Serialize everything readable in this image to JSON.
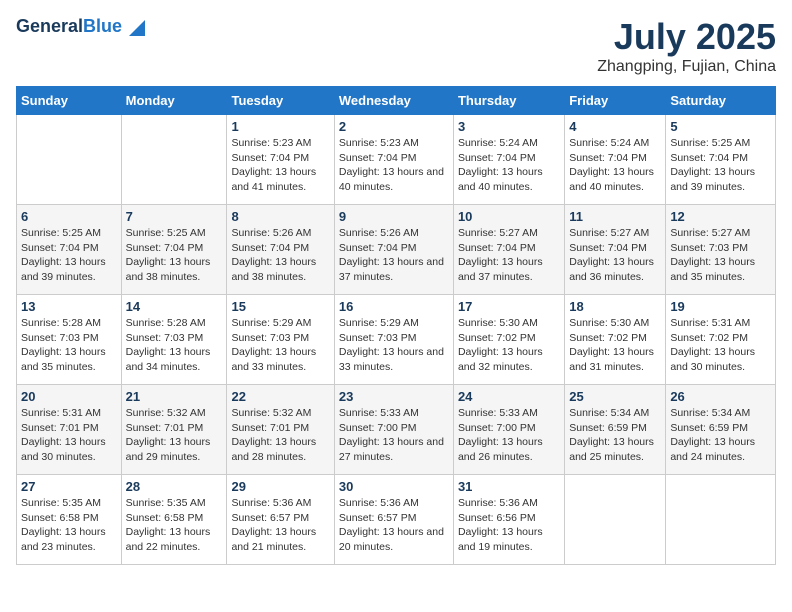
{
  "header": {
    "logo_general": "General",
    "logo_blue": "Blue",
    "month": "July 2025",
    "location": "Zhangping, Fujian, China"
  },
  "weekdays": [
    "Sunday",
    "Monday",
    "Tuesday",
    "Wednesday",
    "Thursday",
    "Friday",
    "Saturday"
  ],
  "weeks": [
    [
      {
        "day": "",
        "info": ""
      },
      {
        "day": "",
        "info": ""
      },
      {
        "day": "1",
        "sunrise": "5:23 AM",
        "sunset": "7:04 PM",
        "daylight": "13 hours and 41 minutes."
      },
      {
        "day": "2",
        "sunrise": "5:23 AM",
        "sunset": "7:04 PM",
        "daylight": "13 hours and 40 minutes."
      },
      {
        "day": "3",
        "sunrise": "5:24 AM",
        "sunset": "7:04 PM",
        "daylight": "13 hours and 40 minutes."
      },
      {
        "day": "4",
        "sunrise": "5:24 AM",
        "sunset": "7:04 PM",
        "daylight": "13 hours and 40 minutes."
      },
      {
        "day": "5",
        "sunrise": "5:25 AM",
        "sunset": "7:04 PM",
        "daylight": "13 hours and 39 minutes."
      }
    ],
    [
      {
        "day": "6",
        "sunrise": "5:25 AM",
        "sunset": "7:04 PM",
        "daylight": "13 hours and 39 minutes."
      },
      {
        "day": "7",
        "sunrise": "5:25 AM",
        "sunset": "7:04 PM",
        "daylight": "13 hours and 38 minutes."
      },
      {
        "day": "8",
        "sunrise": "5:26 AM",
        "sunset": "7:04 PM",
        "daylight": "13 hours and 38 minutes."
      },
      {
        "day": "9",
        "sunrise": "5:26 AM",
        "sunset": "7:04 PM",
        "daylight": "13 hours and 37 minutes."
      },
      {
        "day": "10",
        "sunrise": "5:27 AM",
        "sunset": "7:04 PM",
        "daylight": "13 hours and 37 minutes."
      },
      {
        "day": "11",
        "sunrise": "5:27 AM",
        "sunset": "7:04 PM",
        "daylight": "13 hours and 36 minutes."
      },
      {
        "day": "12",
        "sunrise": "5:27 AM",
        "sunset": "7:03 PM",
        "daylight": "13 hours and 35 minutes."
      }
    ],
    [
      {
        "day": "13",
        "sunrise": "5:28 AM",
        "sunset": "7:03 PM",
        "daylight": "13 hours and 35 minutes."
      },
      {
        "day": "14",
        "sunrise": "5:28 AM",
        "sunset": "7:03 PM",
        "daylight": "13 hours and 34 minutes."
      },
      {
        "day": "15",
        "sunrise": "5:29 AM",
        "sunset": "7:03 PM",
        "daylight": "13 hours and 33 minutes."
      },
      {
        "day": "16",
        "sunrise": "5:29 AM",
        "sunset": "7:03 PM",
        "daylight": "13 hours and 33 minutes."
      },
      {
        "day": "17",
        "sunrise": "5:30 AM",
        "sunset": "7:02 PM",
        "daylight": "13 hours and 32 minutes."
      },
      {
        "day": "18",
        "sunrise": "5:30 AM",
        "sunset": "7:02 PM",
        "daylight": "13 hours and 31 minutes."
      },
      {
        "day": "19",
        "sunrise": "5:31 AM",
        "sunset": "7:02 PM",
        "daylight": "13 hours and 30 minutes."
      }
    ],
    [
      {
        "day": "20",
        "sunrise": "5:31 AM",
        "sunset": "7:01 PM",
        "daylight": "13 hours and 30 minutes."
      },
      {
        "day": "21",
        "sunrise": "5:32 AM",
        "sunset": "7:01 PM",
        "daylight": "13 hours and 29 minutes."
      },
      {
        "day": "22",
        "sunrise": "5:32 AM",
        "sunset": "7:01 PM",
        "daylight": "13 hours and 28 minutes."
      },
      {
        "day": "23",
        "sunrise": "5:33 AM",
        "sunset": "7:00 PM",
        "daylight": "13 hours and 27 minutes."
      },
      {
        "day": "24",
        "sunrise": "5:33 AM",
        "sunset": "7:00 PM",
        "daylight": "13 hours and 26 minutes."
      },
      {
        "day": "25",
        "sunrise": "5:34 AM",
        "sunset": "6:59 PM",
        "daylight": "13 hours and 25 minutes."
      },
      {
        "day": "26",
        "sunrise": "5:34 AM",
        "sunset": "6:59 PM",
        "daylight": "13 hours and 24 minutes."
      }
    ],
    [
      {
        "day": "27",
        "sunrise": "5:35 AM",
        "sunset": "6:58 PM",
        "daylight": "13 hours and 23 minutes."
      },
      {
        "day": "28",
        "sunrise": "5:35 AM",
        "sunset": "6:58 PM",
        "daylight": "13 hours and 22 minutes."
      },
      {
        "day": "29",
        "sunrise": "5:36 AM",
        "sunset": "6:57 PM",
        "daylight": "13 hours and 21 minutes."
      },
      {
        "day": "30",
        "sunrise": "5:36 AM",
        "sunset": "6:57 PM",
        "daylight": "13 hours and 20 minutes."
      },
      {
        "day": "31",
        "sunrise": "5:36 AM",
        "sunset": "6:56 PM",
        "daylight": "13 hours and 19 minutes."
      },
      {
        "day": "",
        "info": ""
      },
      {
        "day": "",
        "info": ""
      }
    ]
  ],
  "labels": {
    "sunrise_prefix": "Sunrise: ",
    "sunset_prefix": "Sunset: ",
    "daylight_prefix": "Daylight: "
  }
}
